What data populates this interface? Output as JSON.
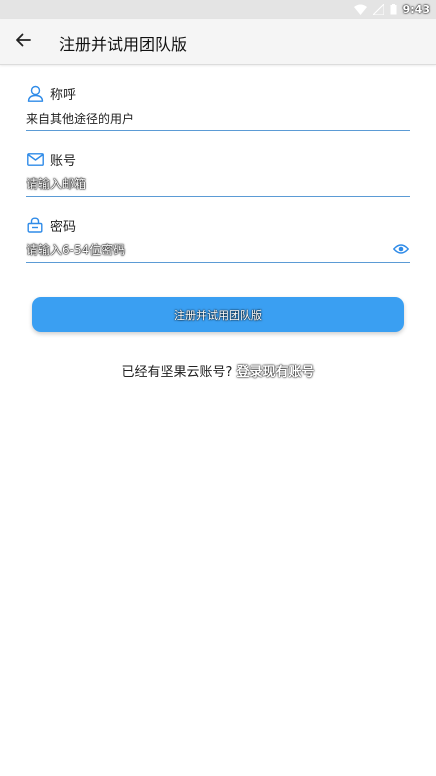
{
  "status_bar": {
    "time": "9:43",
    "icons": [
      "wifi-icon",
      "signal-icon",
      "battery-icon"
    ]
  },
  "app_bar": {
    "title": "注册并试用团队版",
    "back_icon": "arrow-left-icon"
  },
  "form": {
    "name_field": {
      "label": "称呼",
      "icon": "user-icon",
      "value": "来自其他途径的用户"
    },
    "email_field": {
      "label": "账号",
      "icon": "mail-icon",
      "placeholder": "请输入邮箱"
    },
    "password_field": {
      "label": "密码",
      "icon": "lock-icon",
      "placeholder": "请输入6-54位密码",
      "toggle_icon": "eye-icon"
    }
  },
  "submit": {
    "label": "注册并试用团队版"
  },
  "login": {
    "prompt": "已经有坚果云账号?",
    "link": "登录现有账号"
  },
  "colors": {
    "accent": "#3a9ff2",
    "icon_blue": "#2f8be8",
    "underline": "#5b9bd5",
    "app_bar_bg": "#f5f5f5",
    "status_bar_bg": "#e4e4e4"
  }
}
